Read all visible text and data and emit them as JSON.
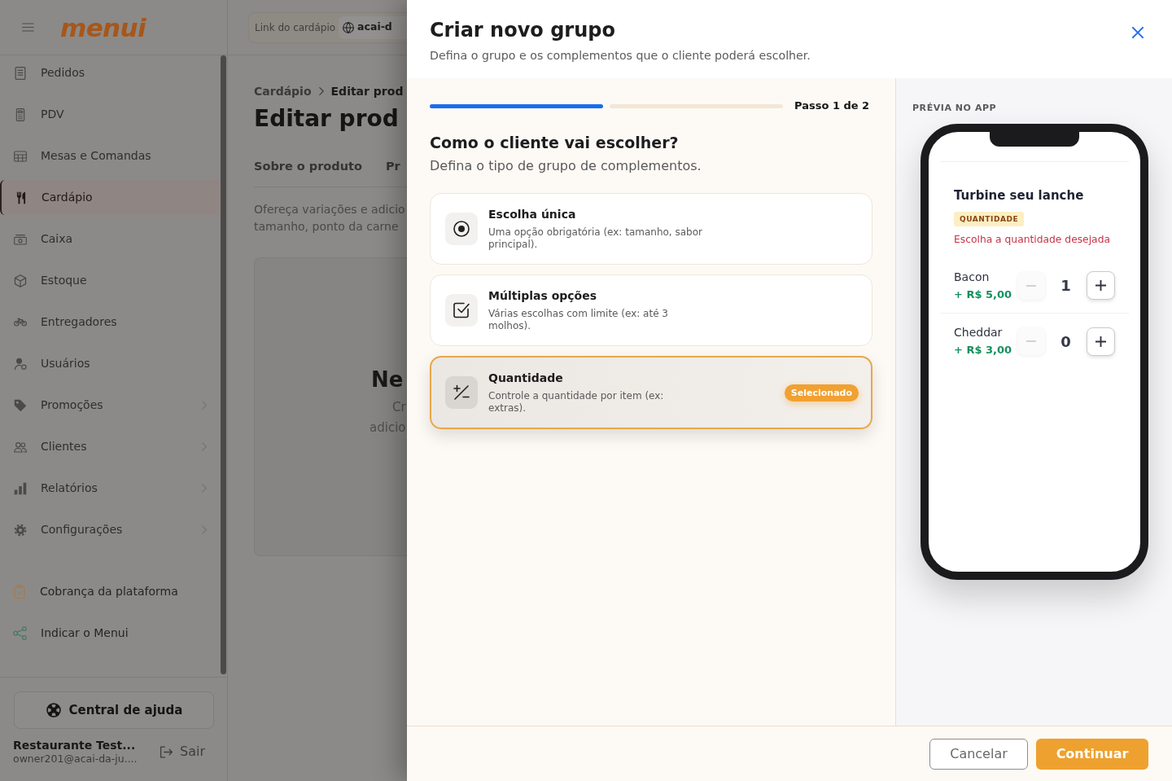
{
  "sidebar": {
    "logo": "menui",
    "items": [
      {
        "label": "Pedidos",
        "selected": false,
        "has_submenu": false
      },
      {
        "label": "PDV",
        "selected": false,
        "has_submenu": false
      },
      {
        "label": "Mesas e Comandas",
        "selected": false,
        "has_submenu": false
      },
      {
        "label": "Cardápio",
        "selected": true,
        "has_submenu": false
      },
      {
        "label": "Caixa",
        "selected": false,
        "has_submenu": false
      },
      {
        "label": "Estoque",
        "selected": false,
        "has_submenu": false
      },
      {
        "label": "Entregadores",
        "selected": false,
        "has_submenu": false
      },
      {
        "label": "Usuários",
        "selected": false,
        "has_submenu": false
      },
      {
        "label": "Promoções",
        "selected": false,
        "has_submenu": true
      },
      {
        "label": "Clientes",
        "selected": false,
        "has_submenu": true
      },
      {
        "label": "Relatórios",
        "selected": false,
        "has_submenu": true
      },
      {
        "label": "Configurações",
        "selected": false,
        "has_submenu": true
      }
    ],
    "links": [
      "Cobrança da plataforma",
      "Indicar o Menui"
    ],
    "help_button": "Central de ajuda",
    "account": {
      "name": "Restaurante Test...",
      "email": "owner201@acai-da-ju....",
      "logout": "Sair"
    }
  },
  "page": {
    "link_label": "Link do cardápio",
    "link_value": "acai-d",
    "breadcrumb": [
      "Cardápio",
      "Editar prod"
    ],
    "title": "Editar prod",
    "tabs": [
      "Sobre o produto",
      "Pr"
    ],
    "description": [
      "Ofereça variações e adicio",
      "tamanho, ponto da carne"
    ],
    "empty_state": {
      "title": "Ne",
      "lines": [
        "Cr",
        "adicio"
      ]
    }
  },
  "modal": {
    "title": "Criar novo grupo",
    "subtitle": "Defina o grupo e os complementos que o cliente poderá escolher.",
    "progress": {
      "steps": [
        {
          "done": true
        },
        {
          "done": false
        }
      ],
      "label": "Passo 1 de 2"
    },
    "question": "Como o cliente vai escolher?",
    "hint": "Defina o tipo de grupo de complementos.",
    "options": [
      {
        "kind": "single",
        "title": "Escolha única",
        "description": "Uma opção obrigatória (ex: tamanho, sabor principal).",
        "selected": false
      },
      {
        "kind": "multiple",
        "title": "Múltiplas opções",
        "description": "Várias escolhas com limite (ex: até 3 molhos).",
        "selected": false
      },
      {
        "kind": "quantity",
        "title": "Quantidade",
        "description": "Controle a quantidade por item (ex: extras).",
        "selected": true
      }
    ],
    "selected_badge": "Selecionado",
    "preview": {
      "label": "PRÉVIA NO APP",
      "group_title": "Turbine seu lanche",
      "type_badge": "QUANTIDADE",
      "instruction": "Escolha a quantidade desejada",
      "items": [
        {
          "name": "Bacon",
          "price": "+ R$ 5,00",
          "quantity": "1",
          "minus_disabled": true
        },
        {
          "name": "Cheddar",
          "price": "+ R$ 3,00",
          "quantity": "0",
          "minus_disabled": true
        }
      ]
    },
    "actions": {
      "cancel": "Cancelar",
      "continue": "Continuar"
    }
  }
}
